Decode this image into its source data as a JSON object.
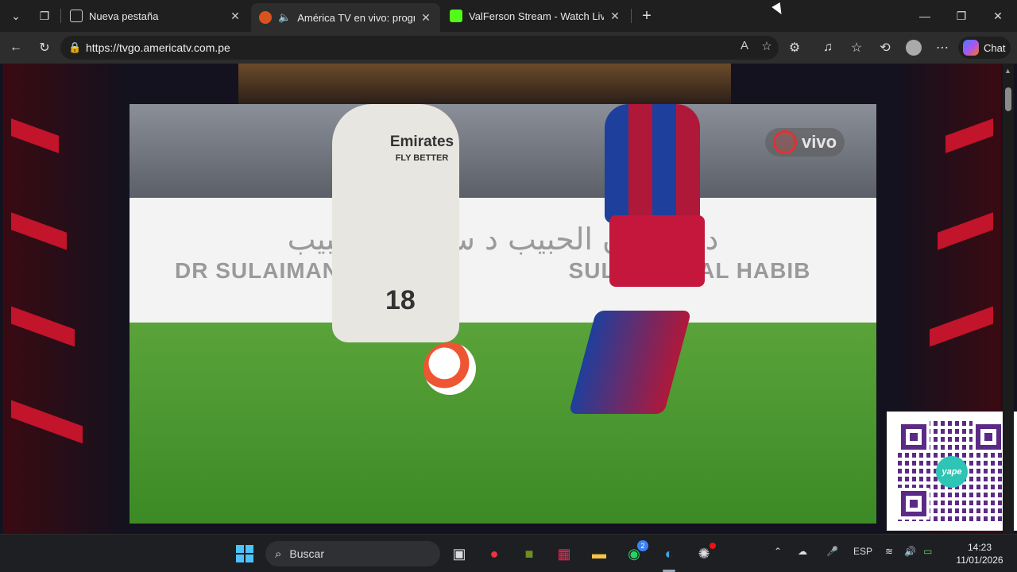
{
  "tabs": [
    {
      "title": "Nueva pestaña",
      "favicon": "new-tab-icon"
    },
    {
      "title": "América TV en vivo: programa",
      "favicon": "americatv-globe-icon",
      "audio": "speaker-icon",
      "active": true
    },
    {
      "title": "ValFerson Stream - Watch Live on",
      "favicon": "kick-icon"
    }
  ],
  "address": {
    "url": "https://tvgo.americatv.com.pe"
  },
  "chat_label": "Chat",
  "video": {
    "badge": "vivo",
    "board_arabic": "د سليمان الحبيب        د سليمان الحبيب",
    "board_en_left": "DR SULAIMAN AL HABIB",
    "board_en_right": "SULAIMAN AL HABIB",
    "shirt_sponsor": "Emirates",
    "shirt_tagline": "FLY BETTER",
    "shirt_number": "18"
  },
  "qr": {
    "brand": "yape",
    "brand_color": "#5b2a86"
  },
  "taskbar": {
    "search_placeholder": "Buscar",
    "language": "ESP",
    "time": "14:23",
    "date": "11/01/2026",
    "whatsapp_badge": "2"
  },
  "colors": {
    "accent_red": "#c2142a",
    "barca_blue": "#1f3f9c",
    "barca_red": "#b0183a"
  }
}
